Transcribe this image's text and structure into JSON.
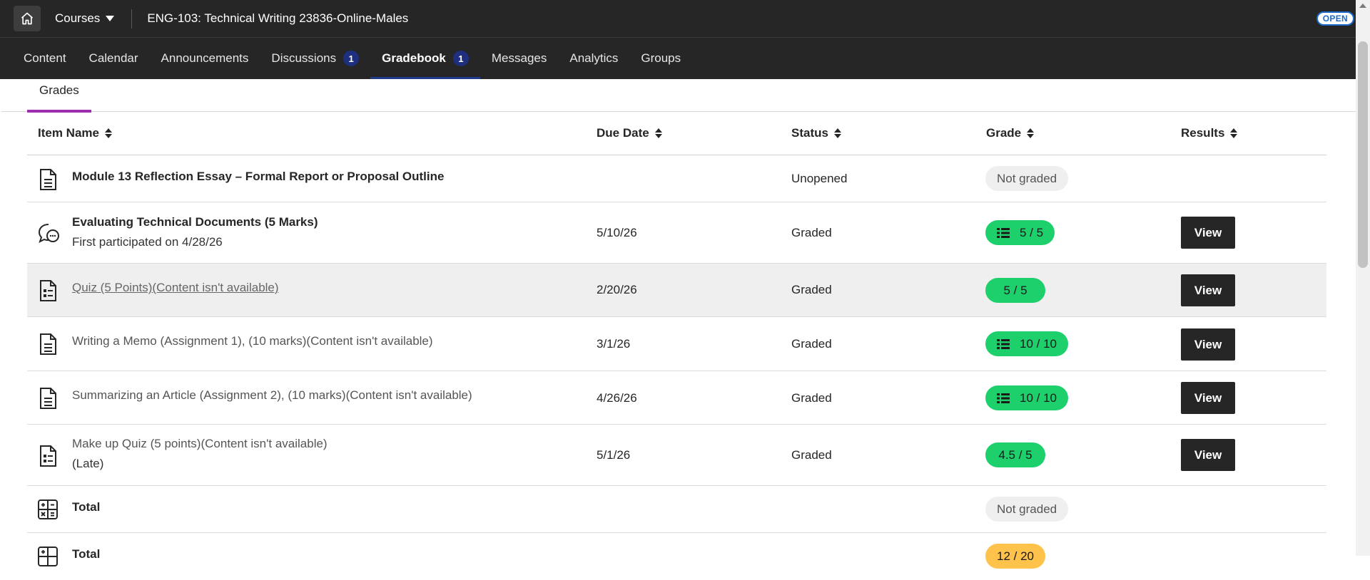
{
  "topbar": {
    "courses_label": "Courses",
    "course_title": "ENG-103: Technical Writing 23836-Online-Males",
    "open_badge": "OPEN"
  },
  "nav": {
    "tabs": [
      {
        "label": "Content",
        "badge": ""
      },
      {
        "label": "Calendar",
        "badge": ""
      },
      {
        "label": "Announcements",
        "badge": ""
      },
      {
        "label": "Discussions",
        "badge": "1"
      },
      {
        "label": "Gradebook",
        "badge": "1",
        "active": true
      },
      {
        "label": "Messages",
        "badge": ""
      },
      {
        "label": "Analytics",
        "badge": ""
      },
      {
        "label": "Groups",
        "badge": ""
      }
    ]
  },
  "subtabs": {
    "grades": "Grades"
  },
  "table": {
    "headers": {
      "item_name": "Item Name",
      "due_date": "Due Date",
      "status": "Status",
      "grade": "Grade",
      "results": "Results"
    },
    "rows": [
      {
        "title": "Module 13 Reflection Essay – Formal Report or Proposal Outline",
        "sub": "",
        "due": "",
        "status": "Unopened",
        "grade": "Not graded",
        "view": ""
      },
      {
        "title": "Evaluating Technical Documents (5 Marks)",
        "sub": "First participated on 4/28/26",
        "due": "5/10/26",
        "status": "Graded",
        "grade": "5 / 5",
        "view": "View"
      },
      {
        "title": "Quiz (5 Points)(Content isn't available)",
        "sub": "",
        "due": "2/20/26",
        "status": "Graded",
        "grade": "5 / 5",
        "view": "View"
      },
      {
        "title": "Writing a Memo (Assignment 1), (10 marks)(Content isn't available)",
        "sub": "",
        "due": "3/1/26",
        "status": "Graded",
        "grade": "10 / 10",
        "view": "View"
      },
      {
        "title": "Summarizing an Article (Assignment 2), (10 marks)(Content isn't available)",
        "sub": "",
        "due": "4/26/26",
        "status": "Graded",
        "grade": "10 / 10",
        "view": "View"
      },
      {
        "title": "Make up Quiz (5 points)(Content isn't available)",
        "sub": "(Late)",
        "due": "5/1/26",
        "status": "Graded",
        "grade": "4.5 / 5",
        "view": "View"
      },
      {
        "title": "Total",
        "sub": "",
        "due": "",
        "status": "",
        "grade": "Not graded",
        "view": ""
      },
      {
        "title": "Total",
        "sub": "",
        "due": "",
        "status": "",
        "grade": "12 / 20",
        "view": ""
      }
    ]
  },
  "colors": {
    "success": "#1ed06c",
    "warning": "#ffc24a",
    "accent_underline": "#9b2fae",
    "badge": "#1e2f80"
  }
}
